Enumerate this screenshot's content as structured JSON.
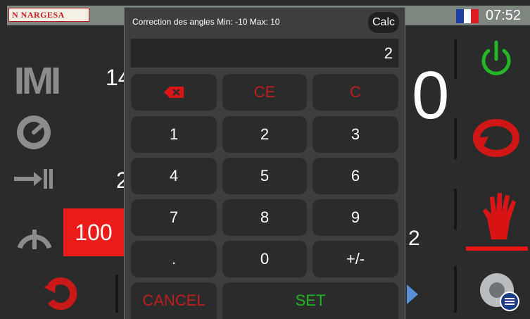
{
  "topbar": {
    "logo_text": "N NARGESA",
    "flag_colors": [
      "#1f3fa8",
      "#ffffff",
      "#e11b22"
    ],
    "time": "07:52"
  },
  "background": {
    "value_m": "14",
    "value_left_middle": "2",
    "value_big": "0",
    "value_red_box": "100",
    "value_bottom_right": "2",
    "left_icons": [
      "m-mode-icon",
      "gauge-icon",
      "stop-position-icon",
      "arc-icon",
      "rotate-icon"
    ],
    "right_icons": [
      "power-icon",
      "cycle-icon",
      "hand-stop-icon",
      "settings-icon"
    ]
  },
  "modal": {
    "title": "Correction des angles Min: -10 Max: 10",
    "calc_label": "Calc",
    "display_value": "2",
    "keys": {
      "backspace": "backspace",
      "ce": "CE",
      "c": "C",
      "k1": "1",
      "k2": "2",
      "k3": "3",
      "k4": "4",
      "k5": "5",
      "k6": "6",
      "k7": "7",
      "k8": "8",
      "k9": "9",
      "dot": ".",
      "k0": "0",
      "sign": "+/-",
      "cancel": "CANCEL",
      "set": "SET"
    }
  },
  "colors": {
    "accent_red": "#e41515",
    "accent_green": "#22b522",
    "key_bg": "#2b2d2d"
  }
}
